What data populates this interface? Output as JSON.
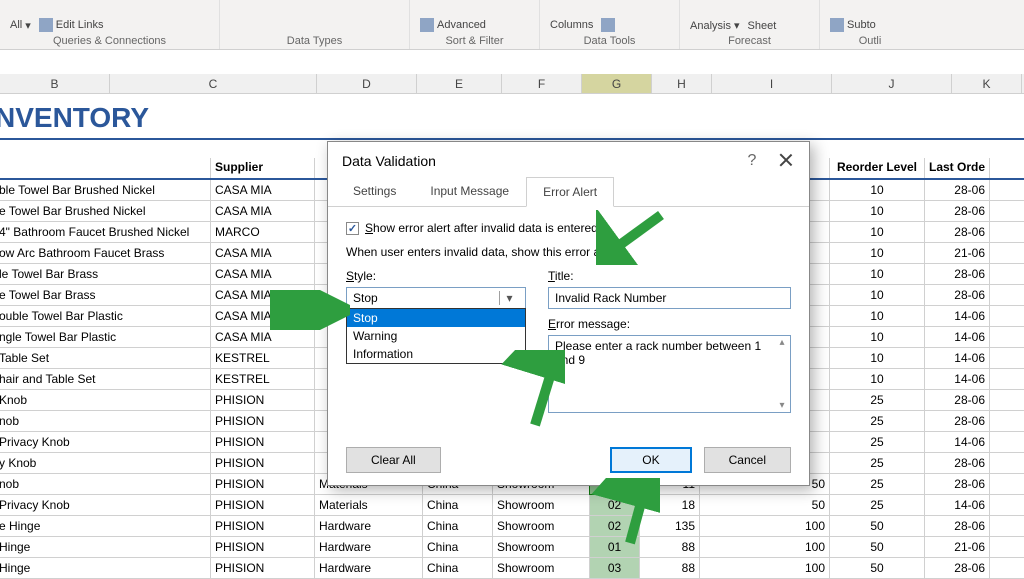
{
  "ribbon": {
    "groups": [
      {
        "label": "Queries & Connections",
        "items": [
          "All",
          "Edit Links"
        ]
      },
      {
        "label": "Data Types",
        "items": []
      },
      {
        "label": "Sort & Filter",
        "items": [
          "Advanced"
        ]
      },
      {
        "label": "Data Tools",
        "items": [
          "Columns"
        ]
      },
      {
        "label": "Forecast",
        "items": [
          "Analysis",
          "Sheet"
        ]
      },
      {
        "label": "Outli",
        "items": [
          "Subto"
        ]
      }
    ]
  },
  "sheet": {
    "title": "NVENTORY",
    "columns": [
      "B",
      "C",
      "D",
      "E",
      "F",
      "G",
      "H",
      "I",
      "J",
      "K"
    ],
    "headers": {
      "name": "",
      "supplier": "Supplier",
      "reorder": "Reorder Level",
      "lastord": "Last Orde"
    },
    "rows": [
      {
        "name": "ble Towel Bar Brushed Nickel",
        "supplier": "CASA MIA",
        "reorder": "10",
        "last": "28-06"
      },
      {
        "name": "e Towel Bar Brushed Nickel",
        "supplier": "CASA MIA",
        "reorder": "10",
        "last": "28-06"
      },
      {
        "name": "4\" Bathroom Faucet Brushed Nickel",
        "supplier": "MARCO",
        "reorder": "10",
        "last": "28-06"
      },
      {
        "name": "ow Arc Bathroom Faucet Brass",
        "supplier": "CASA MIA",
        "reorder": "10",
        "last": "21-06"
      },
      {
        "name": "le Towel Bar Brass",
        "supplier": "CASA MIA",
        "reorder": "10",
        "last": "28-06"
      },
      {
        "name": "e Towel Bar Brass",
        "supplier": "CASA MIA",
        "reorder": "10",
        "last": "28-06"
      },
      {
        "name": "ouble Towel Bar Plastic",
        "supplier": "CASA MIA",
        "reorder": "10",
        "last": "14-06"
      },
      {
        "name": "ngle Towel Bar Plastic",
        "supplier": "CASA MIA",
        "reorder": "10",
        "last": "14-06"
      },
      {
        "name": "Table Set",
        "supplier": "KESTREL",
        "reorder": "10",
        "last": "14-06"
      },
      {
        "name": "hair and Table Set",
        "supplier": "KESTREL",
        "reorder": "10",
        "last": "14-06"
      },
      {
        "name": " Knob",
        "supplier": "PHISION",
        "reorder": "25",
        "last": "28-06"
      },
      {
        "name": "nob",
        "supplier": "PHISION",
        "reorder": "25",
        "last": "28-06"
      },
      {
        "name": "Privacy Knob",
        "supplier": "PHISION",
        "reorder": "25",
        "last": "14-06"
      },
      {
        "name": "y Knob",
        "supplier": "PHISION",
        "reorder": "25",
        "last": "28-06"
      },
      {
        "name": "nob",
        "supplier": "PHISION",
        "c1": "Materials",
        "c2": "China",
        "c3": "Showroom",
        "g": "03",
        "h": "11",
        "i": "50",
        "reorder": "25",
        "last": "28-06"
      },
      {
        "name": " Privacy Knob",
        "supplier": "PHISION",
        "c1": "Materials",
        "c2": "China",
        "c3": "Showroom",
        "g": "02",
        "h": "18",
        "i": "50",
        "reorder": "25",
        "last": "14-06"
      },
      {
        "name": "e Hinge",
        "supplier": "PHISION",
        "c1": "Hardware",
        "c2": "China",
        "c3": "Showroom",
        "g": "02",
        "h": "135",
        "i": "100",
        "reorder": "50",
        "last": "28-06"
      },
      {
        "name": " Hinge",
        "supplier": "PHISION",
        "c1": "Hardware",
        "c2": "China",
        "c3": "Showroom",
        "g": "01",
        "h": "88",
        "i": "100",
        "reorder": "50",
        "last": "21-06"
      },
      {
        "name": "Hinge",
        "supplier": "PHISION",
        "c1": "Hardware",
        "c2": "China",
        "c3": "Showroom",
        "g": "03",
        "h": "88",
        "i": "100",
        "reorder": "50",
        "last": "28-06"
      }
    ]
  },
  "dialog": {
    "title": "Data Validation",
    "help_symbol": "?",
    "tabs": [
      "Settings",
      "Input Message",
      "Error Alert"
    ],
    "active_tab": 2,
    "show_alert_checkbox": "Show error alert after invalid data is entered",
    "prompt": "When user enters invalid data, show this error alert:",
    "style_label": "Style:",
    "style_value": "Stop",
    "style_options": [
      "Stop",
      "Warning",
      "Information"
    ],
    "title_label": "Title:",
    "title_value": "Invalid Rack Number",
    "message_label": "Error message:",
    "message_value": "Please enter a rack number between 1 and 9",
    "clear_all": "Clear All",
    "ok": "OK",
    "cancel": "Cancel"
  }
}
